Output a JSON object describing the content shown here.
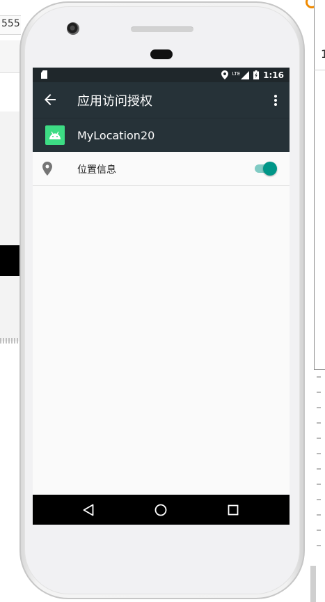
{
  "background": {
    "address_fragment": "555",
    "right_fragment": "1"
  },
  "status_bar": {
    "time": "1:16",
    "network": "LTE"
  },
  "app_bar": {
    "title": "应用访问授权"
  },
  "app_header": {
    "app_name": "MyLocation20"
  },
  "permissions": [
    {
      "label": "位置信息",
      "icon": "location-pin-icon",
      "enabled": true
    }
  ],
  "nav_bar": {
    "buttons": [
      "back-icon",
      "home-icon",
      "recents-icon"
    ]
  },
  "colors": {
    "status_bar": "#1f272b",
    "app_bar": "#263238",
    "switch_thumb": "#009688",
    "switch_track": "#80cbc4",
    "android_green": "#3ddc84",
    "screen_bg": "#fafafa",
    "nav_bar": "#000000"
  }
}
